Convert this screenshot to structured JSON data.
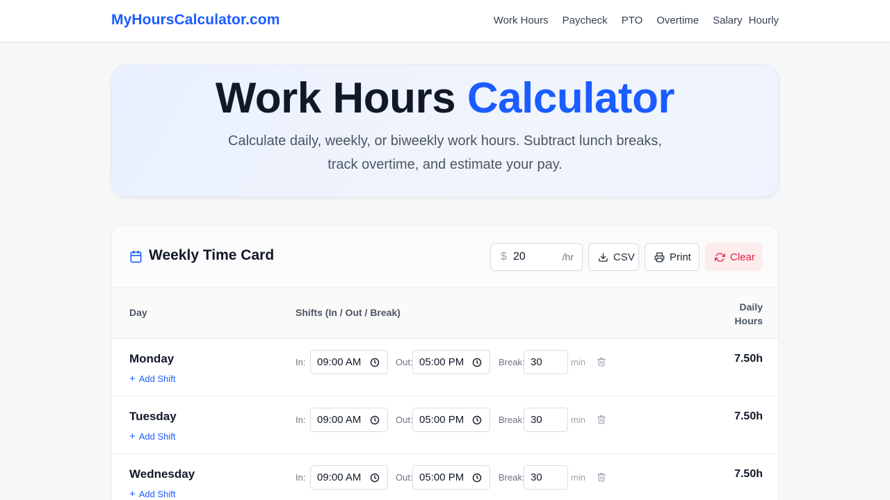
{
  "site": {
    "logo": "MyHoursCalculator.com",
    "nav": [
      "Work Hours",
      "Paycheck",
      "PTO",
      "Overtime",
      "Salary",
      "Hourly"
    ]
  },
  "hero": {
    "title_main": "Work Hours",
    "title_accent": "Calculator",
    "subtitle_line1": "Calculate daily, weekly, or biweekly work hours. Subtract lunch breaks,",
    "subtitle_line2": "track overtime, and estimate your pay."
  },
  "timecard": {
    "title": "Weekly Time Card",
    "title_icon": "calendar-icon",
    "rate": {
      "currency": "$",
      "value": "20",
      "unit": "/hr"
    },
    "buttons": {
      "csv": "CSV",
      "print": "Print",
      "clear": "Clear"
    },
    "columns": {
      "day": "Day",
      "shifts": "Shifts (In / Out / Break)",
      "daily_line1": "Daily",
      "daily_line2": "Hours"
    },
    "labels": {
      "in": "In:",
      "out": "Out:",
      "break": "Break:",
      "min": "min",
      "add_shift": "Add Shift"
    },
    "rows": [
      {
        "day": "Monday",
        "in": "09:00 AM",
        "out": "05:00 PM",
        "break": "30",
        "daily": "7.50h"
      },
      {
        "day": "Tuesday",
        "in": "09:00 AM",
        "out": "05:00 PM",
        "break": "30",
        "daily": "7.50h"
      },
      {
        "day": "Wednesday",
        "in": "09:00 AM",
        "out": "05:00 PM",
        "break": "30",
        "daily": "7.50h"
      }
    ]
  },
  "colors": {
    "brand": "#1a5cff",
    "danger": "#e11d48",
    "danger_bg": "#fdecec"
  }
}
